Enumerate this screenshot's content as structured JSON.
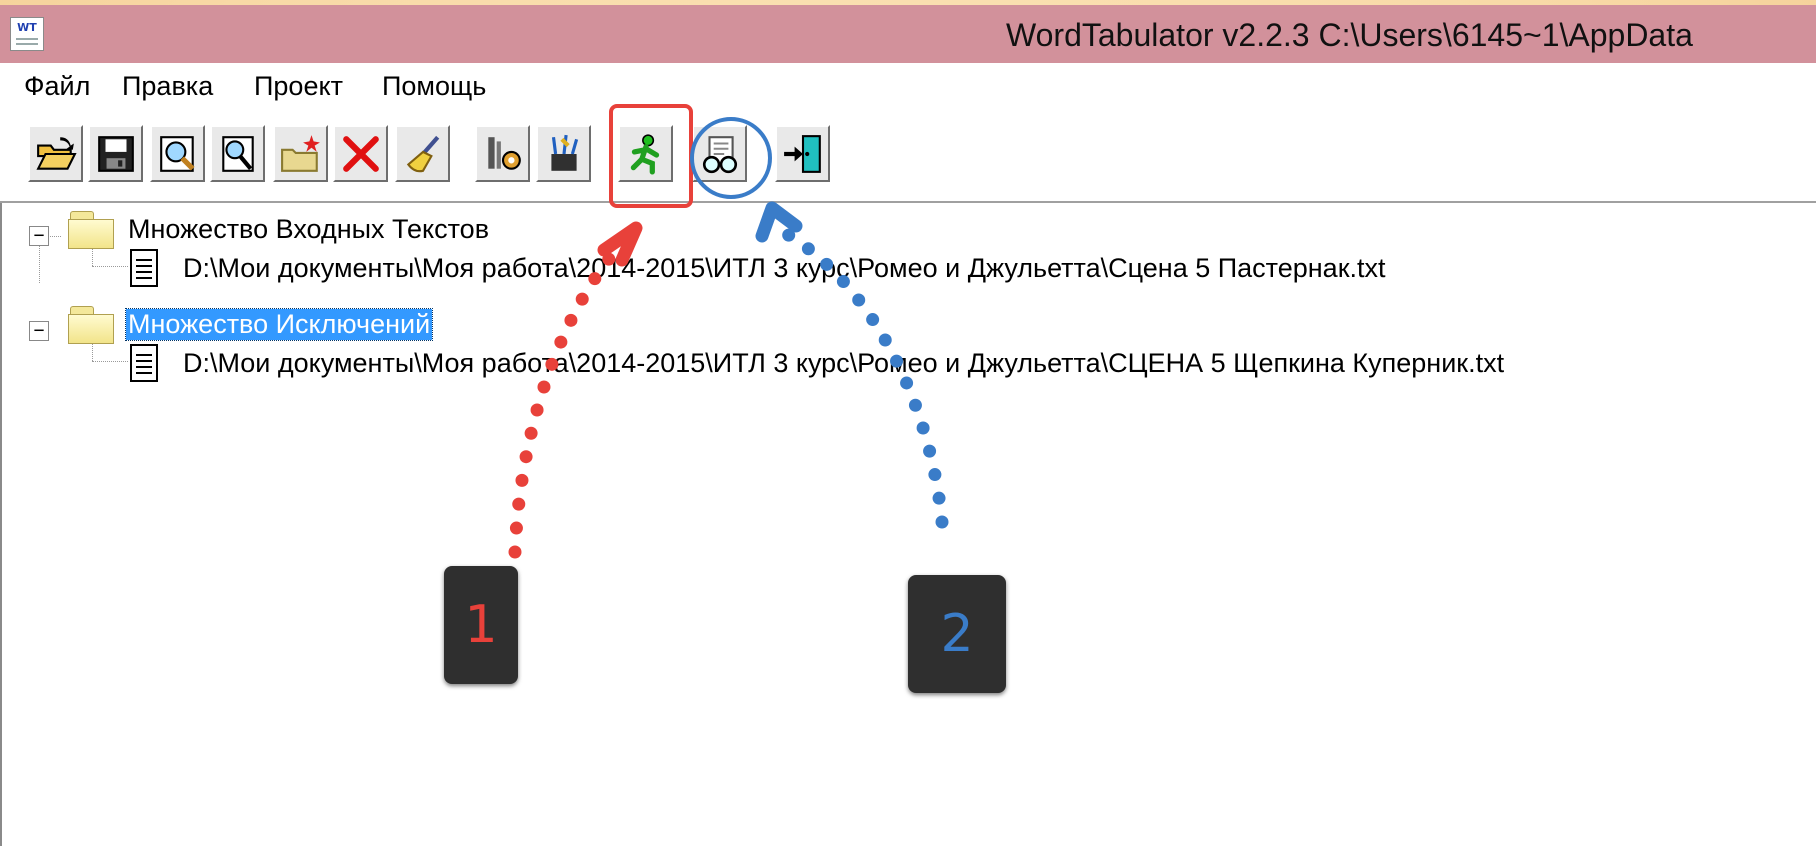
{
  "window": {
    "title": "WordTabulator v2.2.3 C:\\Users\\6145~1\\AppData",
    "app_icon_text": "WT"
  },
  "menu": {
    "items": [
      {
        "label": "Файл"
      },
      {
        "label": "Правка"
      },
      {
        "label": "Проект"
      },
      {
        "label": "Помощь"
      }
    ]
  },
  "toolbar": {
    "buttons": [
      {
        "icon": "open-folder-icon"
      },
      {
        "icon": "save-icon"
      },
      {
        "icon": "find-icon"
      },
      {
        "icon": "find-next-icon"
      },
      {
        "icon": "new-folder-icon"
      },
      {
        "icon": "delete-icon"
      },
      {
        "icon": "clear-icon"
      },
      {
        "icon": "settings-icon"
      },
      {
        "icon": "tools-icon"
      },
      {
        "icon": "run-icon"
      },
      {
        "icon": "view-results-icon"
      },
      {
        "icon": "exit-icon"
      }
    ],
    "highlight_colors": {
      "run": "#e8413a",
      "view": "#3a7cc8"
    }
  },
  "tree": {
    "nodes": [
      {
        "label": "Множество Входных Текстов",
        "expanded": true,
        "selected": false,
        "children": [
          {
            "label": "D:\\Мои документы\\Моя работа\\2014-2015\\ИТЛ 3 курс\\Ромео и Джульетта\\Сцена 5 Пастернак.txt"
          }
        ]
      },
      {
        "label": "Множество Исключений",
        "expanded": true,
        "selected": true,
        "children": [
          {
            "label": "D:\\Мои документы\\Моя работа\\2014-2015\\ИТЛ 3 курс\\Ромео и Джульетта\\СЦЕНА 5 Щепкина Куперник.txt"
          }
        ]
      }
    ],
    "expander_glyph": "−"
  },
  "annotations": [
    {
      "label": "1",
      "color": "#e8413a"
    },
    {
      "label": "2",
      "color": "#3a7cc8"
    }
  ]
}
